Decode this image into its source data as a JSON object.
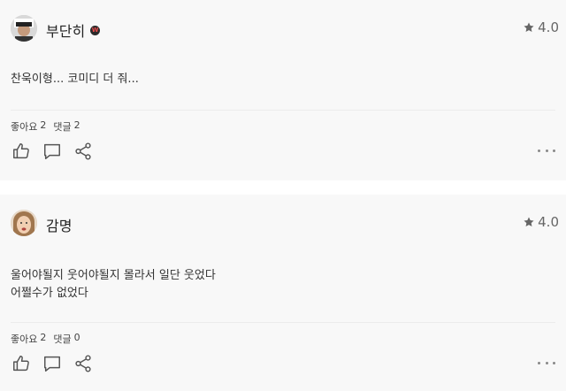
{
  "comments": [
    {
      "username": "부단히",
      "has_badge": true,
      "rating": "4.0",
      "text": "찬욱이형... 코미디 더 줘...",
      "likes_label": "좋아요",
      "likes_count": "2",
      "replies_label": "댓글",
      "replies_count": "2"
    },
    {
      "username": "감명",
      "has_badge": false,
      "rating": "4.0",
      "text": "울어야될지 웃어야될지 몰라서 일단 웃었다\n어쩔수가 없었다",
      "likes_label": "좋아요",
      "likes_count": "2",
      "replies_label": "댓글",
      "replies_count": "0"
    }
  ],
  "icons": {
    "star": "star-icon",
    "like": "thumbs-up-icon",
    "comment": "speech-bubble-icon",
    "share": "share-icon",
    "more": "more-horizontal-icon"
  },
  "colors": {
    "card_background": "#f8f8f8",
    "page_background": "#ffffff",
    "icon": "#555555",
    "badge": "#e94b4b"
  }
}
